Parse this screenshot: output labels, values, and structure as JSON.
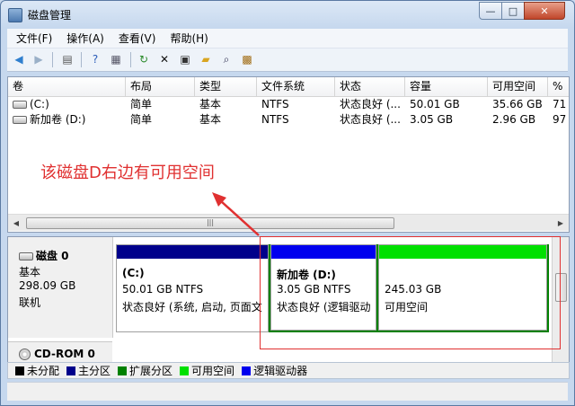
{
  "window": {
    "title": "磁盘管理",
    "controls": {
      "minimize": "—",
      "maximize": "□",
      "close": "✕"
    }
  },
  "menubar": [
    {
      "label": "文件(F)"
    },
    {
      "label": "操作(A)"
    },
    {
      "label": "查看(V)"
    },
    {
      "label": "帮助(H)"
    }
  ],
  "toolbar": [
    {
      "name": "back-icon",
      "glyph": "◀",
      "color": "#2f7fce"
    },
    {
      "name": "forward-icon",
      "glyph": "▶",
      "color": "#9ab0c8"
    },
    {
      "name": "properties-list-icon",
      "glyph": "▤",
      "color": "#555"
    },
    {
      "name": "help-icon",
      "glyph": "?",
      "color": "#2a5bb8"
    },
    {
      "name": "console-tree-icon",
      "glyph": "▦",
      "color": "#556"
    },
    {
      "name": "refresh-icon",
      "glyph": "↻",
      "color": "#2a8a2a"
    },
    {
      "name": "delete-icon",
      "glyph": "✕",
      "color": "#111"
    },
    {
      "name": "properties-icon",
      "glyph": "▣",
      "color": "#333"
    },
    {
      "name": "open-folder-icon",
      "glyph": "▰",
      "color": "#d9a520"
    },
    {
      "name": "search-icon",
      "glyph": "⌕",
      "color": "#335"
    },
    {
      "name": "disk-properties-icon",
      "glyph": "▩",
      "color": "#a06a10"
    }
  ],
  "volume_table": {
    "columns": [
      "卷",
      "布局",
      "类型",
      "文件系统",
      "状态",
      "容量",
      "可用空间",
      "%"
    ],
    "rows": [
      {
        "volume": "(C:)",
        "layout": "简单",
        "type": "基本",
        "fs": "NTFS",
        "status": "状态良好 (...",
        "capacity": "50.01 GB",
        "free": "35.66 GB",
        "pct": "71"
      },
      {
        "volume": "新加卷 (D:)",
        "layout": "简单",
        "type": "基本",
        "fs": "NTFS",
        "status": "状态良好 (...",
        "capacity": "3.05 GB",
        "free": "2.96 GB",
        "pct": "97"
      }
    ],
    "scroll_grip": "|||"
  },
  "annotation": {
    "text": "该磁盘D右边有可用空间",
    "color": "#e03030"
  },
  "disks": [
    {
      "name": "磁盘 0",
      "type": "基本",
      "size": "298.09 GB",
      "state": "联机",
      "partitions": [
        {
          "label": "(C:)",
          "size": "50.01 GB NTFS",
          "status": "状态良好 (系统, 启动, 页面文",
          "bar_color": "#00008b"
        },
        {
          "label": "新加卷  (D:)",
          "size": "3.05 GB NTFS",
          "status": "状态良好 (逻辑驱动",
          "bar_color": "#0000ee"
        },
        {
          "label": "",
          "size": "245.03 GB",
          "status": "可用空间",
          "bar_color": "#00e000"
        }
      ]
    },
    {
      "name": "CD-ROM 0"
    }
  ],
  "legend": [
    {
      "label": "未分配",
      "color": "#000000"
    },
    {
      "label": "主分区",
      "color": "#00008b"
    },
    {
      "label": "扩展分区",
      "color": "#008000"
    },
    {
      "label": "可用空间",
      "color": "#00e000"
    },
    {
      "label": "逻辑驱动器",
      "color": "#0000ee"
    }
  ]
}
